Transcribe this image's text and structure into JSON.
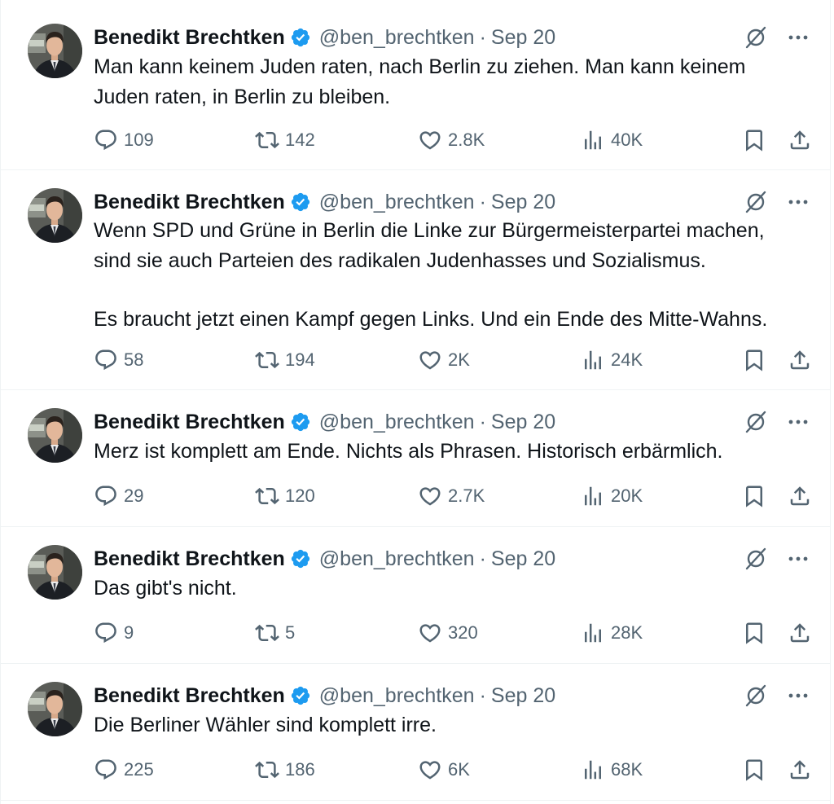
{
  "accent": "#1d9bf0",
  "text_color": "#0f1419",
  "muted_color": "#536471",
  "icons": {
    "verified": "verified-badge-icon",
    "grok": "grok-icon",
    "more": "more-icon",
    "reply": "reply-icon",
    "retweet": "retweet-icon",
    "like": "heart-icon",
    "views": "views-icon",
    "bookmark": "bookmark-icon",
    "share": "share-icon"
  },
  "tweets": [
    {
      "name": "Benedikt Brechtken",
      "handle": "@ben_brechtken",
      "sep": "·",
      "date": "Sep 20",
      "text": [
        "Man kann keinem Juden raten, nach Berlin zu ziehen. Man kann keinem Juden raten, in Berlin zu bleiben."
      ],
      "replies": "109",
      "retweets": "142",
      "likes": "2.8K",
      "views": "40K"
    },
    {
      "name": "Benedikt Brechtken",
      "handle": "@ben_brechtken",
      "sep": "·",
      "date": "Sep 20",
      "text": [
        "Wenn SPD und Grüne in Berlin die Linke zur Bürgermeisterpartei machen, sind sie auch Parteien des radikalen Judenhasses und Sozialismus.",
        "Es braucht jetzt einen Kampf gegen Links. Und ein Ende des Mitte-Wahns."
      ],
      "replies": "58",
      "retweets": "194",
      "likes": "2K",
      "views": "24K"
    },
    {
      "name": "Benedikt Brechtken",
      "handle": "@ben_brechtken",
      "sep": "·",
      "date": "Sep 20",
      "text": [
        "Merz ist komplett am Ende. Nichts als Phrasen. Historisch erbärmlich."
      ],
      "replies": "29",
      "retweets": "120",
      "likes": "2.7K",
      "views": "20K"
    },
    {
      "name": "Benedikt Brechtken",
      "handle": "@ben_brechtken",
      "sep": "·",
      "date": "Sep 20",
      "text": [
        "Das gibt's nicht."
      ],
      "replies": "9",
      "retweets": "5",
      "likes": "320",
      "views": "28K"
    },
    {
      "name": "Benedikt Brechtken",
      "handle": "@ben_brechtken",
      "sep": "·",
      "date": "Sep 20",
      "text": [
        "Die Berliner Wähler sind komplett irre."
      ],
      "replies": "225",
      "retweets": "186",
      "likes": "6K",
      "views": "68K"
    }
  ]
}
